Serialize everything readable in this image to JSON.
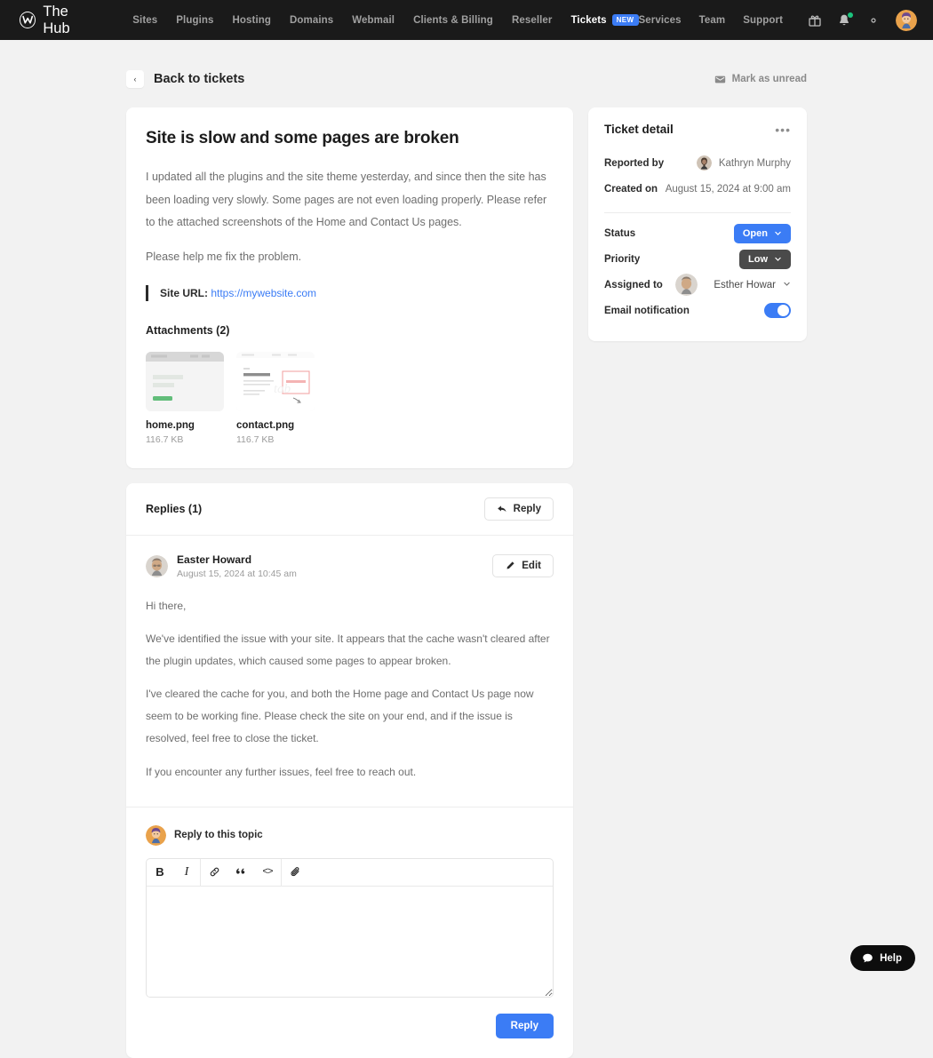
{
  "navbar": {
    "brand": "The Hub",
    "brand_mark": "W",
    "links": [
      {
        "label": "Sites",
        "active": false
      },
      {
        "label": "Plugins",
        "active": false
      },
      {
        "label": "Hosting",
        "active": false
      },
      {
        "label": "Domains",
        "active": false
      },
      {
        "label": "Webmail",
        "active": false
      },
      {
        "label": "Clients & Billing",
        "active": false
      },
      {
        "label": "Reseller",
        "active": false
      },
      {
        "label": "Tickets",
        "active": true,
        "badge": "NEW"
      }
    ],
    "right_links": [
      {
        "label": "Services"
      },
      {
        "label": "Team"
      },
      {
        "label": "Support"
      }
    ],
    "icons": [
      "gift-icon",
      "bell-icon",
      "gear-icon"
    ],
    "has_notification_dot": true,
    "badge_color": "#3b7cf5",
    "background": "#1a1a1a"
  },
  "header": {
    "back_label": "Back to tickets",
    "back_chevron": "‹",
    "mark_unread_label": "Mark as unread"
  },
  "ticket": {
    "title": "Site is slow and some pages are broken",
    "paragraphs": [
      "I updated all the plugins and the site theme yesterday, and since then the site has been loading very slowly. Some pages are not even loading properly. Please refer to the attached screenshots of the Home and Contact Us pages.",
      "Please help me fix the problem."
    ],
    "quote": {
      "label": "Site URL:",
      "link_text": "https://mywebsite.com",
      "link_color": "#3b7cf5"
    },
    "attachments_title": "Attachments (2)",
    "attachments": [
      {
        "name": "home.png",
        "size": "116.7 KB",
        "thumb": "home-screenshot-thumbnail"
      },
      {
        "name": "contact.png",
        "size": "116.7 KB",
        "thumb": "contact-screenshot-thumbnail"
      }
    ]
  },
  "replies": {
    "title": "Replies (1)",
    "reply_button": "Reply",
    "items": [
      {
        "author": "Easter Howard",
        "date": "August 15, 2024 at 10:45 am",
        "edit_label": "Edit",
        "paragraphs": [
          "Hi there,",
          "We've identified the issue with your site. It appears that the cache wasn't cleared after the plugin updates, which caused some pages to appear broken.",
          "I've cleared the cache for you, and both the Home page and Contact Us page now seem to be working fine. Please check the site on your end, and if the issue is resolved, feel free to close the ticket.",
          "If you encounter any further issues, feel free to reach out."
        ]
      }
    ]
  },
  "composer": {
    "label": "Reply to this topic",
    "toolbar": [
      {
        "name": "bold-icon",
        "glyph": "B"
      },
      {
        "name": "italic-icon",
        "glyph": "I"
      },
      {
        "name": "link-icon",
        "glyph": ""
      },
      {
        "name": "quote-icon",
        "glyph": "”"
      },
      {
        "name": "code-icon",
        "glyph": "<>"
      },
      {
        "name": "attachment-icon",
        "glyph": ""
      }
    ],
    "textarea_value": "",
    "textarea_placeholder": "",
    "submit_label": "Reply",
    "submit_color": "#3b7cf5"
  },
  "detail": {
    "title": "Ticket detail",
    "menu_glyph": "•••",
    "reported_by_label": "Reported by",
    "reported_by_value": "Kathryn Murphy",
    "created_on_label": "Created on",
    "created_on_value": "August 15, 2024 at 9:00 am",
    "status_label": "Status",
    "status_value": "Open",
    "status_color": "#3b7cf5",
    "priority_label": "Priority",
    "priority_value": "Low",
    "priority_color": "#4a4a4a",
    "assigned_label": "Assigned to",
    "assigned_value": "Esther Howar",
    "email_label": "Email notification",
    "email_enabled": true
  },
  "help": {
    "label": "Help"
  }
}
